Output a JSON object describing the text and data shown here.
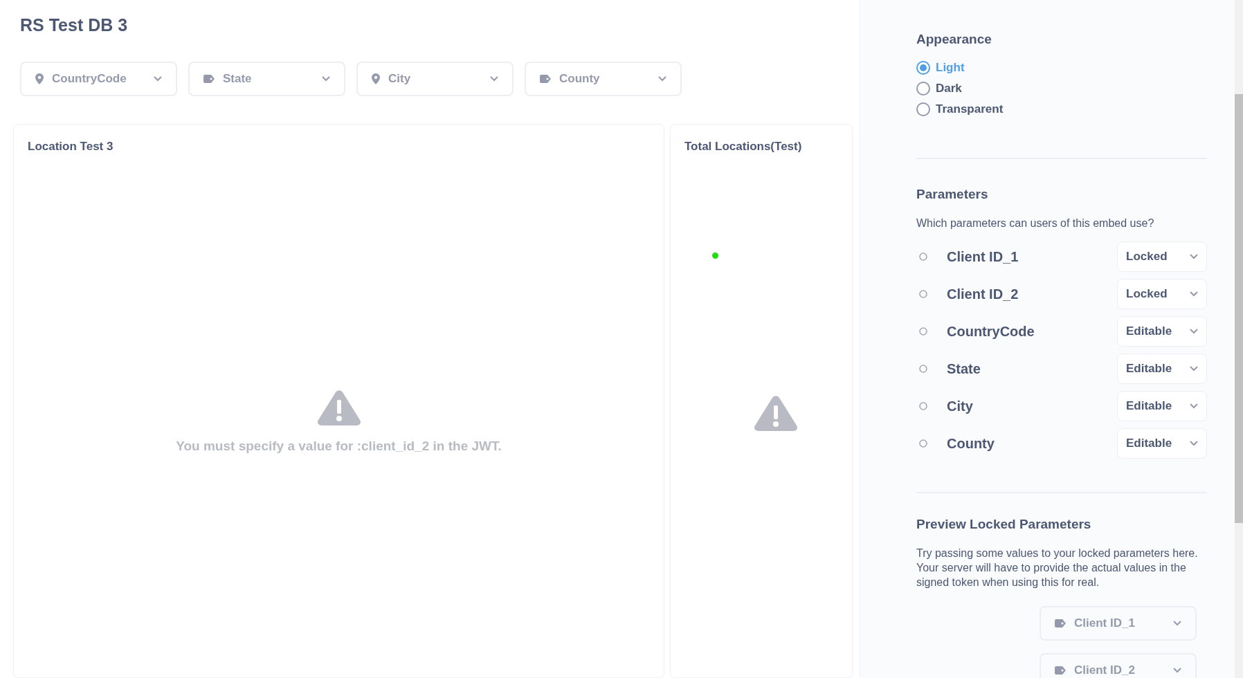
{
  "dashboard": {
    "title": "RS Test DB 3",
    "filters": [
      {
        "label": "CountryCode",
        "kind": "location"
      },
      {
        "label": "State",
        "kind": "category"
      },
      {
        "label": "City",
        "kind": "location"
      },
      {
        "label": "County",
        "kind": "category"
      }
    ],
    "cards": [
      {
        "title": "Location Test 3",
        "kind": "error",
        "message": "You must specify a value for :client_id_2 in the JWT."
      },
      {
        "title": "Total Locations(Test)",
        "kind": "map-error"
      }
    ]
  },
  "sidebar": {
    "appearance": {
      "heading": "Appearance",
      "options": [
        {
          "label": "Light",
          "selected": true
        },
        {
          "label": "Dark",
          "selected": false
        },
        {
          "label": "Transparent",
          "selected": false
        }
      ]
    },
    "parameters": {
      "heading": "Parameters",
      "help": "Which parameters can users of this embed use?",
      "rows": [
        {
          "name": "Client ID_1",
          "value": "Locked"
        },
        {
          "name": "Client ID_2",
          "value": "Locked"
        },
        {
          "name": "CountryCode",
          "value": "Editable"
        },
        {
          "name": "State",
          "value": "Editable"
        },
        {
          "name": "City",
          "value": "Editable"
        },
        {
          "name": "County",
          "value": "Editable"
        }
      ]
    },
    "preview": {
      "heading": "Preview Locked Parameters",
      "help": "Try passing some values to your locked parameters here. Your server will have to provide the actual values in the signed token when using this for real.",
      "filters": [
        {
          "label": "Client ID_1"
        },
        {
          "label": "Client ID_2"
        }
      ]
    }
  }
}
